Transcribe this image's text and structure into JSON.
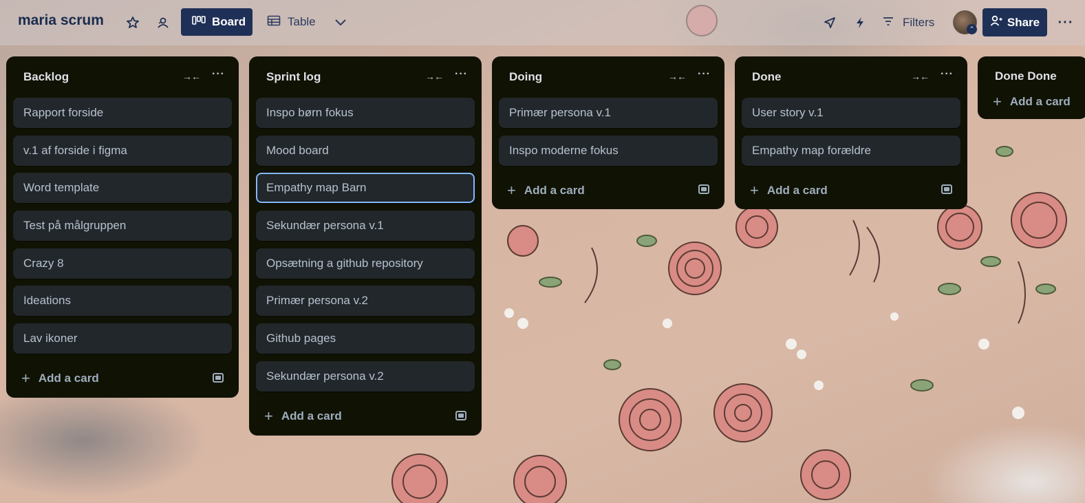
{
  "header": {
    "board_title": "maria scrum",
    "views": {
      "board_label": "Board",
      "table_label": "Table"
    },
    "filters_label": "Filters",
    "share_label": "Share"
  },
  "lists": [
    {
      "title": "Backlog",
      "cards": [
        "Rapport forside",
        "v.1 af forside i figma",
        "Word template",
        "Test på målgruppen",
        "Crazy 8",
        "Ideations",
        "Lav ikoner"
      ],
      "add_label": "Add a card"
    },
    {
      "title": "Sprint log",
      "cards": [
        "Inspo børn fokus",
        "Mood board",
        "Empathy map Barn",
        "Sekundær persona v.1",
        "Opsætning a github repository",
        "Primær persona v.2",
        "Github pages",
        "Sekundær persona v.2"
      ],
      "focused_card": "Empathy map Barn",
      "add_label": "Add a card"
    },
    {
      "title": "Doing",
      "cards": [
        "Primær persona v.1",
        "Inspo moderne fokus"
      ],
      "add_label": "Add a card"
    },
    {
      "title": "Done",
      "cards": [
        "User story v.1",
        "Empathy map forældre"
      ],
      "add_label": "Add a card"
    },
    {
      "title": "Done Done",
      "cards": [],
      "add_label": "Add a card"
    }
  ],
  "colors": {
    "header_button_bg": "#1f3057",
    "list_bg": "#101204",
    "card_bg": "#22272b",
    "card_text": "#b6c2cf",
    "focus_ring": "#85b8ff"
  },
  "icons": {
    "star": "star-icon",
    "workspace_visibility": "people-icon",
    "board_view": "board-columns-icon",
    "table_view": "table-icon",
    "views_dropdown": "chevron-down-icon",
    "power_ups": "rocket-icon",
    "automation": "lightning-icon",
    "filters": "filter-icon",
    "share": "add-person-icon",
    "collapse_list": "collapse-arrows-icon",
    "list_menu": "ellipsis-icon",
    "add_card": "plus-icon",
    "create_from_template": "template-icon"
  }
}
